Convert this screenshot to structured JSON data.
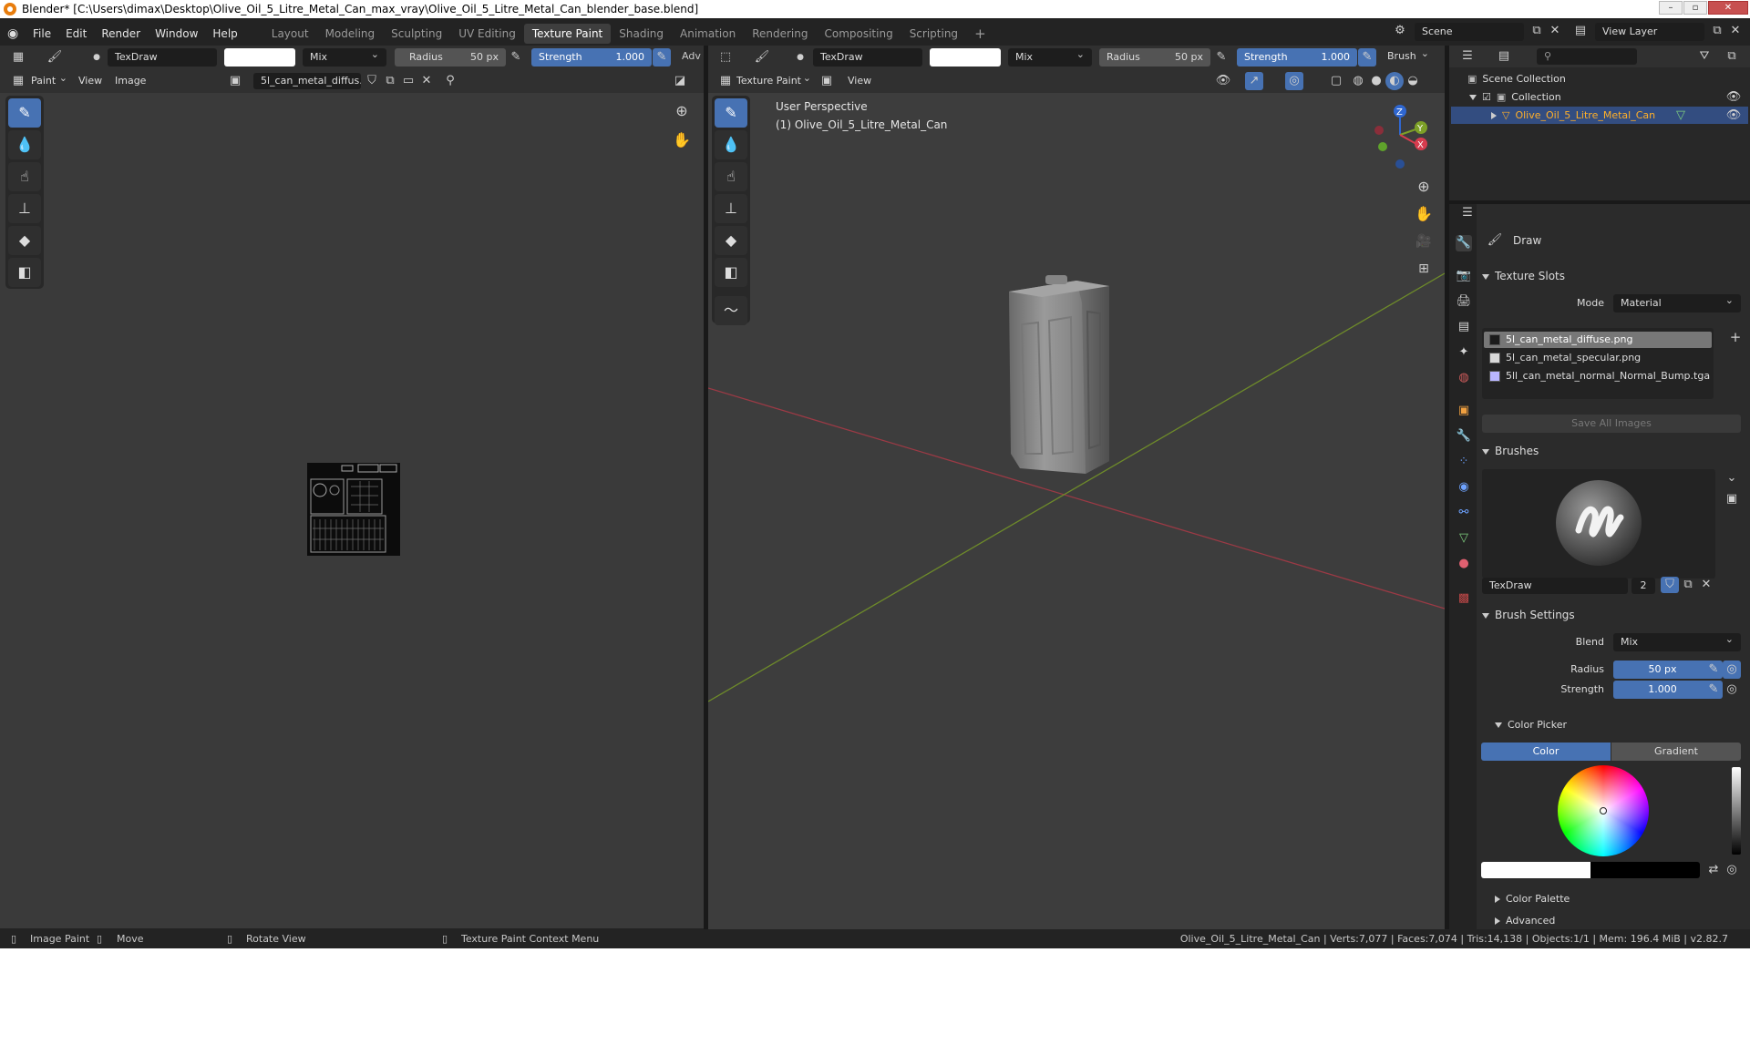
{
  "window": {
    "title": "Blender* [C:\\Users\\dimax\\Desktop\\Olive_Oil_5_Litre_Metal_Can_max_vray\\Olive_Oil_5_Litre_Metal_Can_blender_base.blend]"
  },
  "menu": [
    "File",
    "Edit",
    "Render",
    "Window",
    "Help"
  ],
  "workspaces": [
    "Layout",
    "Modeling",
    "Sculpting",
    "UV Editing",
    "Texture Paint",
    "Shading",
    "Animation",
    "Rendering",
    "Compositing",
    "Scripting"
  ],
  "active_workspace": "Texture Paint",
  "scene": {
    "label": "Scene",
    "view_layer": "View Layer"
  },
  "image_editor": {
    "brush_name": "TexDraw",
    "blend": "Mix",
    "radius_label": "Radius",
    "radius_value": "50 px",
    "strength_label": "Strength",
    "strength_value": "1.000",
    "adv_label": "Adv",
    "mode": "Paint",
    "menus": [
      "View",
      "Image"
    ],
    "image_name": "5l_can_metal_diffus..."
  },
  "viewport": {
    "brush_name": "TexDraw",
    "blend": "Mix",
    "radius_label": "Radius",
    "radius_value": "50 px",
    "strength_label": "Strength",
    "strength_value": "1.000",
    "brush_menu": "Brush",
    "mode": "Texture Paint",
    "view_menu": "View",
    "overlay_title": "User Perspective",
    "overlay_object": "(1) Olive_Oil_5_Litre_Metal_Can",
    "gizmo": {
      "z": "Z",
      "y": "Y",
      "x": "X"
    }
  },
  "outliner": {
    "root": "Scene Collection",
    "collection": "Collection",
    "object": "Olive_Oil_5_Litre_Metal_Can"
  },
  "properties": {
    "tool_name": "Draw",
    "texture_slots_title": "Texture Slots",
    "mode_label": "Mode",
    "mode_value": "Material",
    "slots": [
      {
        "name": "5l_can_metal_diffuse.png",
        "color": "#1b1b1b"
      },
      {
        "name": "5l_can_metal_specular.png",
        "color": "#d8d8d8"
      },
      {
        "name": "5ll_can_metal_normal_Normal_Bump.tga",
        "color": "#b9b6ff"
      }
    ],
    "save_all": "Save All Images",
    "brushes_title": "Brushes",
    "brush_name": "TexDraw",
    "brush_users": "2",
    "brush_settings_title": "Brush Settings",
    "blend_label": "Blend",
    "blend_value": "Mix",
    "radius_label": "Radius",
    "radius_value": "50 px",
    "strength_label": "Strength",
    "strength_value": "1.000",
    "color_picker_title": "Color Picker",
    "tab_color": "Color",
    "tab_gradient": "Gradient",
    "color_palette": "Color Palette",
    "advanced": "Advanced"
  },
  "status": {
    "left1": "Image Paint",
    "left2": "Move",
    "left3": "Rotate View",
    "left4": "Texture Paint Context Menu",
    "right": "Olive_Oil_5_Litre_Metal_Can | Verts:7,077 | Faces:7,074 | Tris:14,138 | Objects:1/1 | Mem: 196.4 MiB | v2.82.7"
  },
  "colors": {
    "accent": "#4772b3",
    "bg": "#232323",
    "panel": "#303030",
    "viewport": "#3d3d3d",
    "axis_x": "#9b3a45",
    "axis_y": "#6e8b2a"
  }
}
